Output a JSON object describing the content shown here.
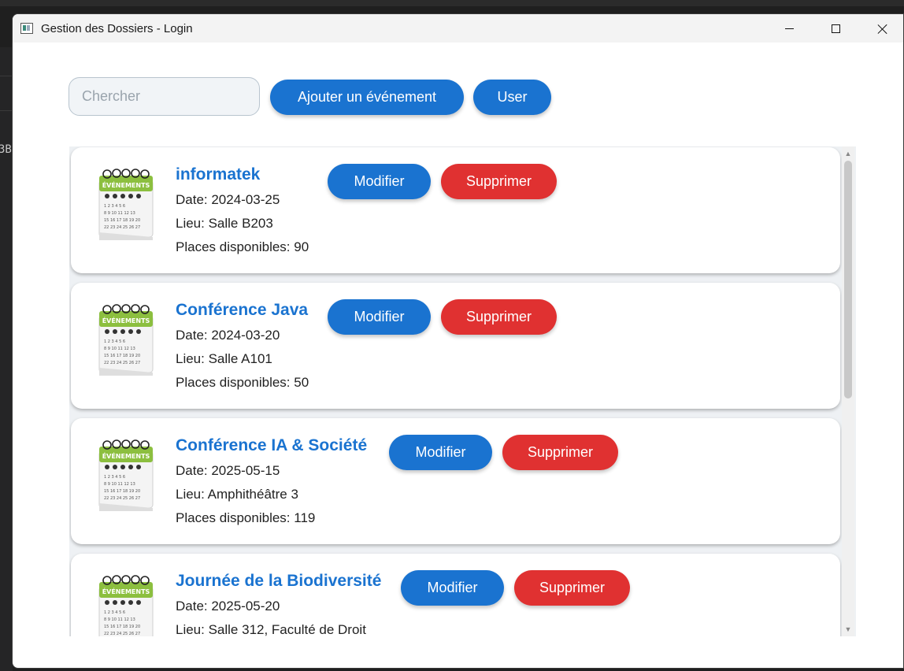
{
  "window": {
    "title": "Gestion des Dossiers - Login"
  },
  "toolbar": {
    "search_placeholder": "Chercher",
    "add_label": "Ajouter un événement",
    "user_label": "User"
  },
  "events": [
    {
      "title": "informatek",
      "date": "Date: 2024-03-25",
      "lieu": "Lieu: Salle B203",
      "places": "Places disponibles: 90",
      "modify": "Modifier",
      "delete": "Supprimer",
      "icon": "calendar-evenements-icon"
    },
    {
      "title": "Conférence Java",
      "date": "Date: 2024-03-20",
      "lieu": "Lieu: Salle A101",
      "places": "Places disponibles: 50",
      "modify": "Modifier",
      "delete": "Supprimer",
      "icon": "calendar-evenements-icon"
    },
    {
      "title": "Conférence IA & Société",
      "date": "Date: 2025-05-15",
      "lieu": "Lieu: Amphithéâtre 3",
      "places": "Places disponibles: 119",
      "modify": "Modifier",
      "delete": "Supprimer",
      "icon": "calendar-evenements-icon"
    },
    {
      "title": "Journée de la Biodiversité",
      "date": "Date: 2025-05-20",
      "lieu": "Lieu: Salle 312, Faculté de Droit",
      "places": "",
      "modify": "Modifier",
      "delete": "Supprimer",
      "icon": "calendar-evenements-icon"
    }
  ],
  "calendar_icon": {
    "header": "ÉVÉNEMENTS"
  },
  "desktop": {
    "edge_text": "3B"
  },
  "colors": {
    "primary": "#1a73d0",
    "danger": "#e03131",
    "calendar_green": "#8cbf3f"
  }
}
